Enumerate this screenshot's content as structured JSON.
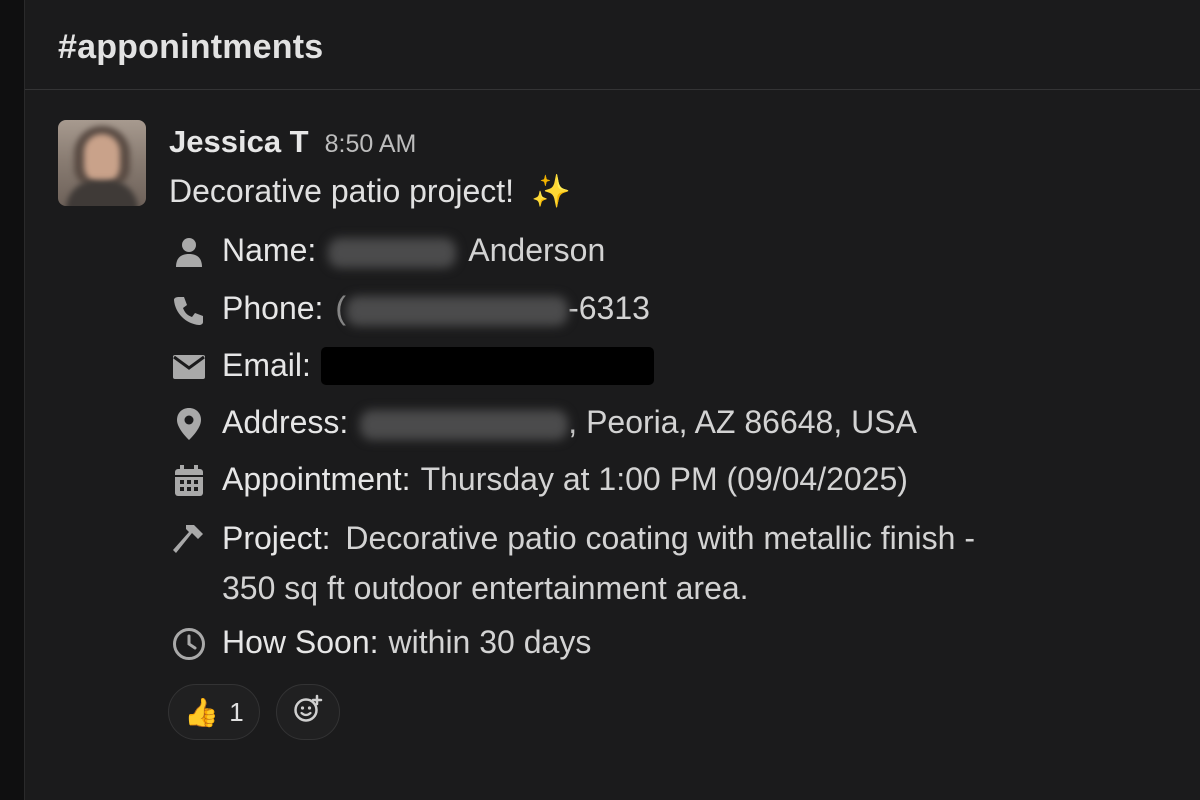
{
  "channel": {
    "title": "#apponintments"
  },
  "message": {
    "author": "Jessica T",
    "time": "8:50 AM",
    "text": "Decorative patio project!",
    "emoji": "✨",
    "fields": [
      {
        "icon": "user-icon",
        "label": "Name:",
        "value": "Anderson"
      },
      {
        "icon": "phone-icon",
        "label": "Phone:",
        "prefix": "(",
        "value": "-6313"
      },
      {
        "icon": "mail-icon",
        "label": "Email:",
        "value": ""
      },
      {
        "icon": "location-pin-icon",
        "label": "Address:",
        "value": ", Peoria, AZ 86648, USA"
      },
      {
        "icon": "calendar-icon",
        "label": "Appointment:",
        "value": "Thursday at 1:00 PM (09/04/2025)"
      },
      {
        "icon": "hammer-icon",
        "label": "Project:",
        "value": "Decorative patio coating with metallic finish -",
        "value_line2": "350 sq ft outdoor entertainment area."
      },
      {
        "icon": "clock-icon",
        "label": "How Soon:",
        "value": "within 30 days"
      }
    ]
  },
  "reactions": [
    {
      "emoji": "👍",
      "count": "1"
    },
    {
      "icon": "add-reaction-icon"
    }
  ]
}
